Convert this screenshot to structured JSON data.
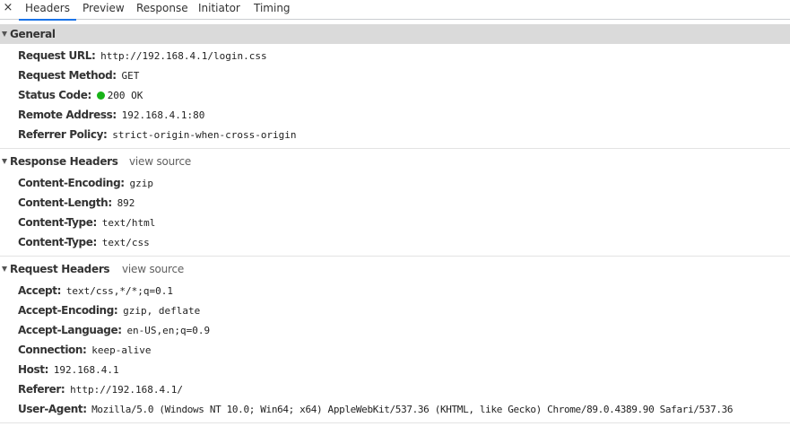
{
  "tabs": {
    "close_glyph": "×",
    "items": [
      "Headers",
      "Preview",
      "Response",
      "Initiator",
      "Timing"
    ],
    "active": "Headers",
    "accent_color": "#1a73e8"
  },
  "general": {
    "title": "General",
    "rows": [
      {
        "key": "Request URL:",
        "value": "http://192.168.4.1/login.css"
      },
      {
        "key": "Request Method:",
        "value": "GET"
      },
      {
        "key": "Status Code:",
        "value": "200 OK",
        "status_color": "#18b318"
      },
      {
        "key": "Remote Address:",
        "value": "192.168.4.1:80"
      },
      {
        "key": "Referrer Policy:",
        "value": "strict-origin-when-cross-origin"
      }
    ]
  },
  "response_headers": {
    "title": "Response Headers",
    "view_source": "view source",
    "rows": [
      {
        "key": "Content-Encoding:",
        "value": "gzip"
      },
      {
        "key": "Content-Length:",
        "value": "892"
      },
      {
        "key": "Content-Type:",
        "value": "text/html"
      },
      {
        "key": "Content-Type:",
        "value": "text/css"
      }
    ]
  },
  "request_headers": {
    "title": "Request Headers",
    "view_source": "view source",
    "rows": [
      {
        "key": "Accept:",
        "value": "text/css,*/*;q=0.1"
      },
      {
        "key": "Accept-Encoding:",
        "value": "gzip, deflate"
      },
      {
        "key": "Accept-Language:",
        "value": "en-US,en;q=0.9"
      },
      {
        "key": "Connection:",
        "value": "keep-alive"
      },
      {
        "key": "Host:",
        "value": "192.168.4.1"
      },
      {
        "key": "Referer:",
        "value": "http://192.168.4.1/"
      },
      {
        "key": "User-Agent:",
        "value": "Mozilla/5.0 (Windows NT 10.0; Win64; x64) AppleWebKit/537.36 (KHTML, like Gecko) Chrome/89.0.4389.90 Safari/537.36"
      }
    ]
  }
}
